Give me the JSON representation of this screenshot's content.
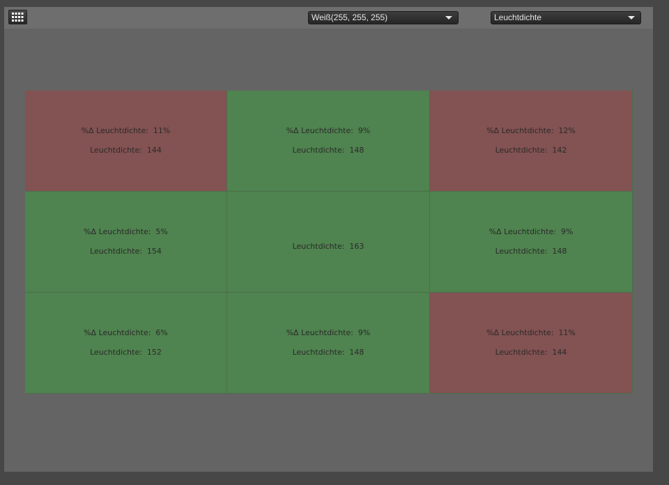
{
  "toolbar": {
    "grid_icon": "grid-icon",
    "color_select": {
      "selected": "Weiß(255, 255, 255)"
    },
    "metric_select": {
      "selected": "Leuchtdichte"
    }
  },
  "colors": {
    "pass": "#4f834f",
    "fail": "#835252"
  },
  "cells": [
    {
      "status": "fail",
      "delta": "%Δ Leuchtdichte:  11%",
      "value": "Leuchtdichte:  144"
    },
    {
      "status": "pass",
      "delta": "%Δ Leuchtdichte:  9%",
      "value": "Leuchtdichte:  148"
    },
    {
      "status": "fail",
      "delta": "%Δ Leuchtdichte:  12%",
      "value": "Leuchtdichte:  142"
    },
    {
      "status": "pass",
      "delta": "%Δ Leuchtdichte:  5%",
      "value": "Leuchtdichte:  154"
    },
    {
      "status": "pass",
      "delta": "",
      "value": "Leuchtdichte:  163"
    },
    {
      "status": "pass",
      "delta": "%Δ Leuchtdichte:  9%",
      "value": "Leuchtdichte:  148"
    },
    {
      "status": "pass",
      "delta": "%Δ Leuchtdichte:  6%",
      "value": "Leuchtdichte:  152"
    },
    {
      "status": "pass",
      "delta": "%Δ Leuchtdichte:  9%",
      "value": "Leuchtdichte:  148"
    },
    {
      "status": "fail",
      "delta": "%Δ Leuchtdichte:  11%",
      "value": "Leuchtdichte:  144"
    }
  ]
}
